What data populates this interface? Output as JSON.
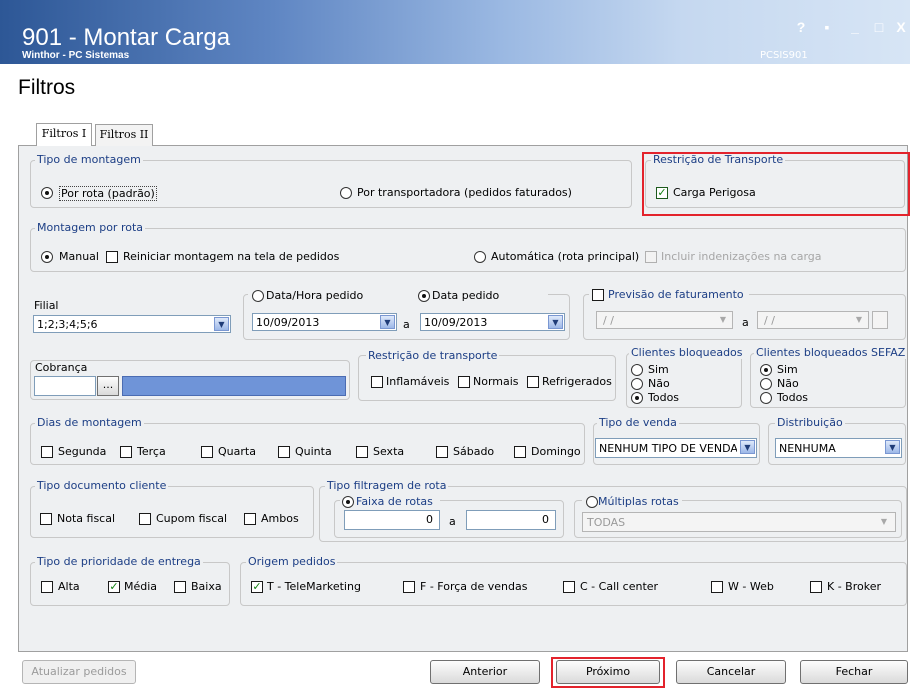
{
  "window": {
    "title": "901 - Montar Carga",
    "subtitle": "Winthor - PC Sistemas",
    "code": "PCSIS901",
    "controls": {
      "help": "?",
      "restore": "▪",
      "minimize": "_",
      "maximize": "□",
      "close": "X"
    }
  },
  "page": {
    "heading": "Filtros"
  },
  "tabs": [
    {
      "label": "Filtros I",
      "active": true
    },
    {
      "label": "Filtros II",
      "active": false
    }
  ],
  "tipo_montagem": {
    "title": "Tipo de montagem",
    "opt1": "Por rota (padrão)",
    "opt2": "Por transportadora (pedidos faturados)",
    "selected": "opt1"
  },
  "restricao_top": {
    "title": "Restrição de Transporte",
    "carga_perigosa": "Carga Perigosa",
    "checked": true
  },
  "montagem_rota": {
    "title": "Montagem por rota",
    "manual": "Manual",
    "reiniciar": "Reiniciar montagem na tela de pedidos",
    "automatica": "Automática (rota principal)",
    "incluir": "Incluir indenizações na carga"
  },
  "filial": {
    "label": "Filial",
    "value": "1;2;3;4;5;6"
  },
  "data": {
    "opt_hora": "Data/Hora pedido",
    "opt_pedido": "Data pedido",
    "from": "10/09/2013",
    "sep": "a",
    "to": "10/09/2013"
  },
  "previsao": {
    "label": "Previsão de faturamento",
    "from": "/ /",
    "sep": "a",
    "to": "/ /"
  },
  "cobranca": {
    "label": "Cobrança",
    "button": "..."
  },
  "restricao": {
    "title": "Restrição de transporte",
    "inflamaveis": "Inflamáveis",
    "normais": "Normais",
    "refrigerados": "Refrigerados"
  },
  "clientes_bloq": {
    "title": "Clientes bloqueados",
    "sim": "Sim",
    "nao": "Não",
    "todos": "Todos"
  },
  "clientes_sefaz": {
    "title": "Clientes bloqueados SEFAZ",
    "sim": "Sim",
    "nao": "Não",
    "todos": "Todos"
  },
  "dias": {
    "title": "Dias de montagem",
    "items": [
      "Segunda",
      "Terça",
      "Quarta",
      "Quinta",
      "Sexta",
      "Sábado",
      "Domingo"
    ]
  },
  "tipo_venda": {
    "title": "Tipo de venda",
    "value": "NENHUM TIPO DE VENDA"
  },
  "distribuicao": {
    "title": "Distribuição",
    "value": "NENHUMA"
  },
  "tipo_doc": {
    "title": "Tipo documento cliente",
    "nota": "Nota fiscal",
    "cupom": "Cupom fiscal",
    "ambos": "Ambos"
  },
  "filtragem": {
    "title": "Tipo filtragem de rota",
    "faixa": "Faixa de rotas",
    "from": "0",
    "sep": "a",
    "to": "0"
  },
  "multiplas": {
    "title": "Múltiplas rotas",
    "value": "TODAS"
  },
  "prioridade": {
    "title": "Tipo de prioridade  de  entrega",
    "alta": "Alta",
    "media": "Média",
    "baixa": "Baixa"
  },
  "origem": {
    "title": "Origem pedidos",
    "t": "T - TeleMarketing",
    "f": "F - Força de vendas",
    "c": "C - Call center",
    "w": "W - Web",
    "k": "K - Broker"
  },
  "buttons": {
    "atualizar": "Atualizar pedidos",
    "anterior": "Anterior",
    "proximo": "Próximo",
    "cancelar": "Cancelar",
    "fechar": "Fechar"
  },
  "colors": {
    "highlight": "#e3232c",
    "group_title": "#1c3e85",
    "selection": "#6f94d8"
  }
}
